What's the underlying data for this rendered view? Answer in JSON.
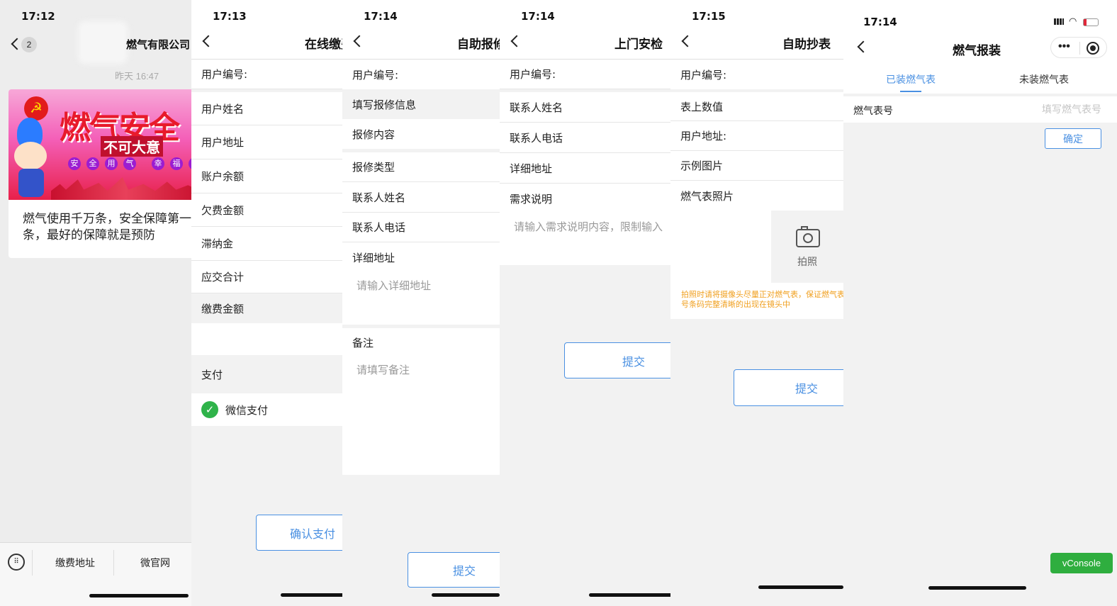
{
  "p1": {
    "time": "17:12",
    "back_count": "2",
    "title": "燃气有限公司",
    "timestamp": "昨天 16:47",
    "banner_big": "燃气安全",
    "banner_sub": "不可大意",
    "banner_circles": [
      "安",
      "全",
      "用",
      "气",
      "幸",
      "福",
      "家"
    ],
    "article_text": "燃气使用千万条，安全保障第一条，最好的保障就是预防",
    "menu": [
      "缴费地址",
      "微官网"
    ]
  },
  "p2": {
    "time": "17:13",
    "title": "在线缴费",
    "rows": [
      "用户编号:",
      "用户姓名",
      "用户地址",
      "账户余额",
      "欠费金额",
      "滞纳金",
      "应交合计",
      "缴费金额"
    ],
    "pay_header": "支付",
    "wechat_pay": "微信支付",
    "button": "确认支付"
  },
  "p3": {
    "time": "17:14",
    "title": "自助报修",
    "user_no": "用户编号:",
    "section": "填写报修信息",
    "content_label": "报修内容",
    "rows": [
      "报修类型",
      "联系人姓名",
      "联系人电话"
    ],
    "addr_label": "详细地址",
    "addr_placeholder": "请输入详细地址",
    "note_label": "备注",
    "note_placeholder": "请填写备注",
    "button": "提交"
  },
  "p4": {
    "time": "17:14",
    "title": "上门安检",
    "rows": [
      "用户编号:",
      "联系人姓名",
      "联系人电话",
      "详细地址",
      "需求说明"
    ],
    "desc_placeholder": "请输入需求说明内容，限制输入",
    "button": "提交"
  },
  "p5": {
    "time": "17:15",
    "title": "自助抄表",
    "rows": [
      "用户编号:",
      "表上数值",
      "用户地址:",
      "示例图片",
      "燃气表照片"
    ],
    "photo_label": "拍照",
    "hint": "拍照时请将摄像头尽量正对燃气表，保证燃气表号条码完整清晰的出现在镜头中",
    "button": "提交",
    "hint_color": "#f0a020"
  },
  "p6": {
    "time": "17:14",
    "title": "燃气报装",
    "tabs": [
      "已装燃气表",
      "未装燃气表"
    ],
    "field_label": "燃气表号",
    "field_placeholder": "填写燃气表号",
    "confirm": "确定",
    "vconsole": "vConsole",
    "accent": "#4a90e2",
    "vconsole_color": "#2fae3f"
  }
}
